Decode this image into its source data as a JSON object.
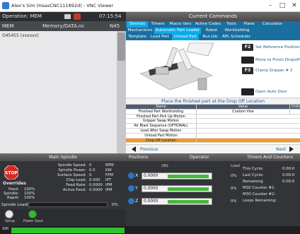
{
  "window": {
    "title": "Alex's Sim (HaasCNC111892d) - VNC Viewer",
    "minimize": "–",
    "maximize": "□",
    "close": "✕"
  },
  "left": {
    "operation": "Operation: MEM",
    "time": "07:15:54",
    "mem_label": "MEM",
    "program_path": "Memory/DATA.nc",
    "line_number": "N45",
    "program_text": "O45455 (xxxxxx)"
  },
  "commands": {
    "title": "Current Commands",
    "tabs_row1": [
      "Devices",
      "Timers",
      "Macro Vars",
      "Active Codes",
      "Tools",
      "Plane",
      "Calculator"
    ],
    "tabs_row2": [
      "Mechanisms",
      "Automatic Part Loader",
      "Robot",
      "Workholding"
    ],
    "tabs_row3": [
      "Template",
      "Load Part",
      "Unload Part",
      "Run Job",
      "APL Scheduler"
    ],
    "functions": [
      {
        "key": "F2",
        "label": "Set Reference Position"
      },
      {
        "key": "",
        "label": "Move to Finish Dropoff"
      },
      {
        "key": "F3",
        "label": "Clamp Gripper # 2"
      },
      {
        "key": "",
        "label": "Open Auto Door"
      }
    ],
    "instruction": "Place the finished part at the Drop Off Location",
    "table": {
      "headers": [
        "Name",
        "Value",
        "Units"
      ],
      "rows": [
        {
          "name": "Finished Part Workholding",
          "value": "Custom Vise",
          "unit": ""
        },
        {
          "name": "Finished Part Pick Up Motion",
          "value": "",
          "unit": ""
        },
        {
          "name": "Gripper Swap Motion",
          "value": "",
          "unit": ""
        },
        {
          "name": "Air Blast Sequence (OPTIONAL)",
          "value": "",
          "unit": ""
        },
        {
          "name": "Load After Swap Motion",
          "value": "",
          "unit": ""
        },
        {
          "name": "Unload Part Motion",
          "value": "",
          "unit": ""
        },
        {
          "name": "Drop Off Location",
          "value": "",
          "unit": ""
        }
      ]
    },
    "previous": "Previous",
    "next": "Next",
    "colors": {
      "tab_bar": "#1a6fa0",
      "tab_active": "#0ea9e8",
      "highlight_row": "#f29a25"
    }
  },
  "main_spindle": {
    "title": "Main Spindle",
    "stop": "STOP",
    "overrides_title": "Overrides",
    "overrides": [
      {
        "label": "Feed:",
        "value": "100%"
      },
      {
        "label": "Spindle:",
        "value": "100%"
      },
      {
        "label": "Rapid:",
        "value": "100%"
      }
    ],
    "readouts": [
      {
        "label": "Spindle Speed:",
        "value": "0",
        "unit": "RPM"
      },
      {
        "label": "Spindle Power:",
        "value": "0.0",
        "unit": "KW"
      },
      {
        "label": "Surface Speed:",
        "value": "0",
        "unit": "FPM"
      },
      {
        "label": "Chip Load:",
        "value": "0.000",
        "unit": "IPT"
      },
      {
        "label": "Feed Rate:",
        "value": "0.0000",
        "unit": "IPM"
      },
      {
        "label": "Active Feed:",
        "value": "0.0000",
        "unit": "IPM"
      }
    ],
    "load_label": "Spindle Load(%)",
    "load_value": "0%"
  },
  "bottom_icons": {
    "setup": "Setup",
    "power_save": "Power Save"
  },
  "positions": {
    "title": "Positions",
    "mode": "Operator",
    "unit_header": "(IN)",
    "load_header": "Load",
    "axes": [
      {
        "letter": "X",
        "value": "0.0000",
        "load": "0%"
      },
      {
        "letter": "Y",
        "value": "0.0000",
        "load": "0%"
      },
      {
        "letter": "Z",
        "value": "0.0000",
        "load": "0%"
      }
    ]
  },
  "timers": {
    "title": "Timers And Counters",
    "lines": [
      {
        "label": "This Cycle:",
        "value": "0:00:0"
      },
      {
        "label": "Last Cycle:",
        "value": "0:00:0"
      },
      {
        "label": "Remaining",
        "value": "0:00:0"
      },
      {
        "label": "M30 Counter #1:",
        "value": ""
      },
      {
        "label": "M30 Counter #2:",
        "value": ""
      },
      {
        "label": "Loops Remaining:",
        "value": ""
      }
    ]
  },
  "status": {
    "text": "SIM"
  }
}
